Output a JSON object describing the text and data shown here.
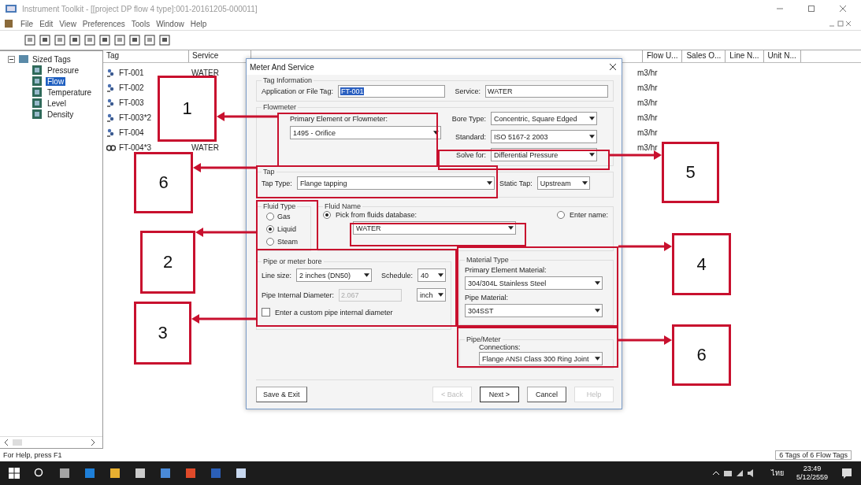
{
  "window": {
    "title": "Instrument Toolkit - [[project DP flow 4 type]:001-20161205-000011]"
  },
  "menu": [
    "File",
    "Edit",
    "View",
    "Preferences",
    "Tools",
    "Window",
    "Help"
  ],
  "tree": {
    "label": "Sized Tags",
    "expanded": true,
    "children": [
      {
        "label": "Pressure",
        "selected": false
      },
      {
        "label": "Flow",
        "selected": true
      },
      {
        "label": "Temperature",
        "selected": false
      },
      {
        "label": "Level",
        "selected": false
      },
      {
        "label": "Density",
        "selected": false
      }
    ]
  },
  "table": {
    "columns": [
      "Tag",
      "Service",
      "Flow U...",
      "Sales O...",
      "Line N...",
      "Unit N..."
    ],
    "rows": [
      {
        "tag": "FT-001",
        "service": "WATER",
        "flow_units": "m3/hr",
        "kind": "tag"
      },
      {
        "tag": "FT-002",
        "service": "",
        "flow_units": "m3/hr",
        "kind": "tag"
      },
      {
        "tag": "FT-003",
        "service": "",
        "flow_units": "m3/hr",
        "kind": "tag"
      },
      {
        "tag": "FT-003*2",
        "service": "",
        "flow_units": "m3/hr",
        "kind": "tag"
      },
      {
        "tag": "FT-004",
        "service": "",
        "flow_units": "m3/hr",
        "kind": "tag"
      },
      {
        "tag": "FT-004*3",
        "service": "WATER",
        "flow_units": "m3/hr",
        "kind": "multi"
      }
    ]
  },
  "dialog": {
    "title": "Meter And Service",
    "tag_info": {
      "title": "Tag Information",
      "app_tag_label": "Application or File Tag:",
      "app_tag_value": "FT-001",
      "service_label": "Service:",
      "service_value": "WATER"
    },
    "flowmeter": {
      "title": "Flowmeter",
      "primary_label": "Primary Element or Flowmeter:",
      "primary_value": "1495 - Orifice",
      "fields": [
        {
          "label": "Bore Type:",
          "value": "Concentric, Square Edged"
        },
        {
          "label": "Standard:",
          "value": "ISO 5167-2 2003"
        },
        {
          "label": "Solve for:",
          "value": "Differential Pressure"
        }
      ]
    },
    "tap": {
      "title": "Tap",
      "tap_type_label": "Tap Type:",
      "tap_type_value": "Flange tapping",
      "static_label": "Static Tap:",
      "static_value": "Upstream"
    },
    "fluid_type": {
      "title": "Fluid Type",
      "options": [
        {
          "label": "Gas",
          "selected": false
        },
        {
          "label": "Liquid",
          "selected": true
        },
        {
          "label": "Steam",
          "selected": false
        }
      ]
    },
    "fluid_name": {
      "title": "Fluid Name",
      "options": [
        {
          "label": "Pick from fluids database:",
          "selected": true
        },
        {
          "label": "Enter name:",
          "selected": false
        }
      ],
      "value": "WATER"
    },
    "pipe": {
      "title": "Pipe or meter bore",
      "line_size_label": "Line size:",
      "line_size_value": "2 inches (DN50)",
      "schedule_label": "Schedule:",
      "schedule_value": "40",
      "diameter_label": "Pipe Internal Diameter:",
      "diameter_value": "2.067",
      "diameter_disabled": true,
      "unit_value": "inch",
      "custom_label": "Enter a custom pipe internal diameter",
      "custom_checked": false
    },
    "material": {
      "title": "Material Type",
      "primary_label": "Primary Element Material:",
      "primary_value": "304/304L Stainless Steel",
      "pipe_label": "Pipe Material:",
      "pipe_value": "304SST"
    },
    "pipe_meter": {
      "title": "Pipe/Meter",
      "connections_label": "Connections:",
      "connections_value": "Flange ANSI Class 300 Ring Joint"
    },
    "buttons": [
      {
        "label": "Save & Exit",
        "disabled": false,
        "default": false
      },
      {
        "label": "< Back",
        "disabled": true,
        "default": false
      },
      {
        "label": "Next >",
        "disabled": false,
        "default": true
      },
      {
        "label": "Cancel",
        "disabled": false,
        "default": false
      },
      {
        "label": "Help",
        "disabled": true,
        "default": false
      }
    ]
  },
  "annotations": [
    {
      "label": "1"
    },
    {
      "label": "6"
    },
    {
      "label": "2"
    },
    {
      "label": "3"
    },
    {
      "label": "5"
    },
    {
      "label": "4"
    },
    {
      "label": "6"
    }
  ],
  "status_bar": {
    "left": "For Help, press F1",
    "right": "6 Tags of 6 Flow Tags"
  },
  "taskbar": {
    "language": "ไทย",
    "time": "23:49",
    "date": "5/12/2559"
  }
}
